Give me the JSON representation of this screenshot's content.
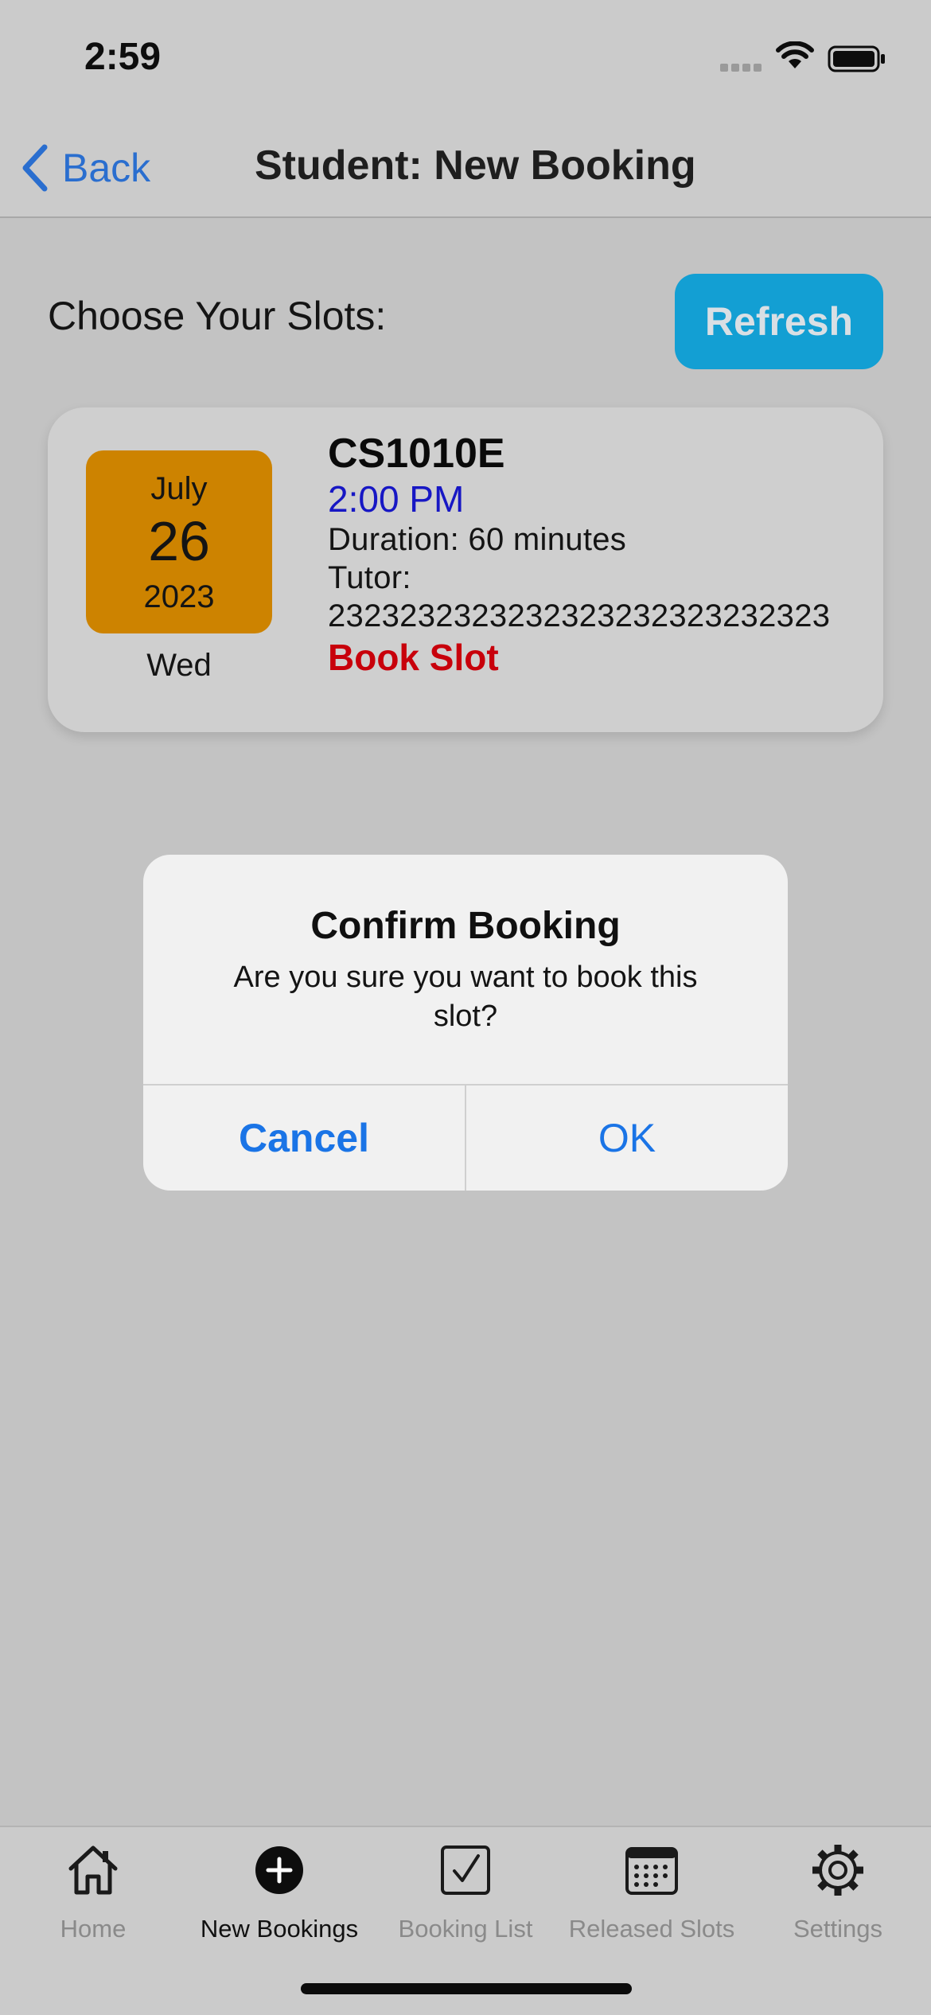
{
  "status_bar": {
    "time": "2:59"
  },
  "nav": {
    "back_label": "Back",
    "title": "Student: New Booking"
  },
  "main": {
    "section_label": "Choose Your Slots:",
    "refresh_label": "Refresh",
    "slots": [
      {
        "month": "July",
        "day": "26",
        "year": "2023",
        "weekday": "Wed",
        "course": "CS1010E",
        "time": "2:00 PM",
        "duration": "Duration: 60 minutes",
        "tutor_label": "Tutor:",
        "tutor_id": "2323232323232323232323232323",
        "action_label": "Book Slot"
      }
    ]
  },
  "dialog": {
    "title": "Confirm Booking",
    "message": "Are you sure you want to book this slot?",
    "cancel_label": "Cancel",
    "ok_label": "OK"
  },
  "tab_bar": {
    "active_index": 1,
    "items": [
      {
        "label": "Home",
        "icon": "home-icon"
      },
      {
        "label": "New Bookings",
        "icon": "plus-circle-icon"
      },
      {
        "label": "Booking List",
        "icon": "checkbox-icon"
      },
      {
        "label": "Released Slots",
        "icon": "calendar-icon"
      },
      {
        "label": "Settings",
        "icon": "gear-icon"
      }
    ]
  },
  "colors": {
    "accent_blue": "#1a74e6",
    "refresh_button": "#139fd3",
    "date_tile": "#cd8300",
    "slot_time": "#1717c4",
    "book_slot": "#c8000b"
  }
}
